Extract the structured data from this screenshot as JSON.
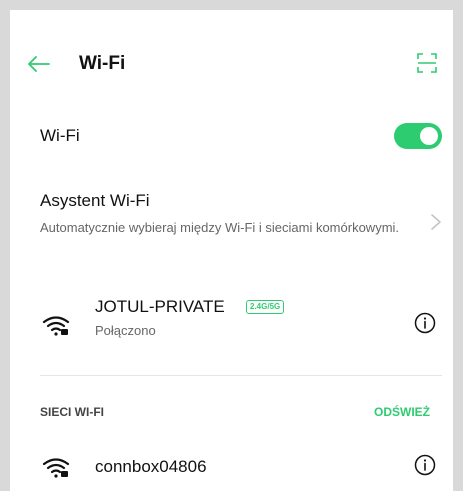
{
  "header": {
    "title": "Wi-Fi",
    "back_icon": "arrow-left-icon",
    "scan_icon": "qr-scan-icon"
  },
  "wifi_toggle": {
    "label": "Wi-Fi",
    "enabled": true
  },
  "assistant": {
    "title": "Asystent Wi-Fi",
    "description": "Automatycznie wybieraj między Wi-Fi i sieciami komórkowymi."
  },
  "connected_network": {
    "name": "JOTUL-PRIVATE",
    "band_badge": "2.4G/5G",
    "status": "Połączono"
  },
  "networks_section": {
    "label": "SIECI WI-FI",
    "refresh_label": "ODŚWIEŻ",
    "items": [
      {
        "name": "connbox04806"
      }
    ]
  },
  "colors": {
    "accent": "#2ecc71",
    "text_primary": "#111111",
    "text_secondary": "#666666",
    "background": "#ffffff",
    "frame": "#d9d9d9"
  }
}
